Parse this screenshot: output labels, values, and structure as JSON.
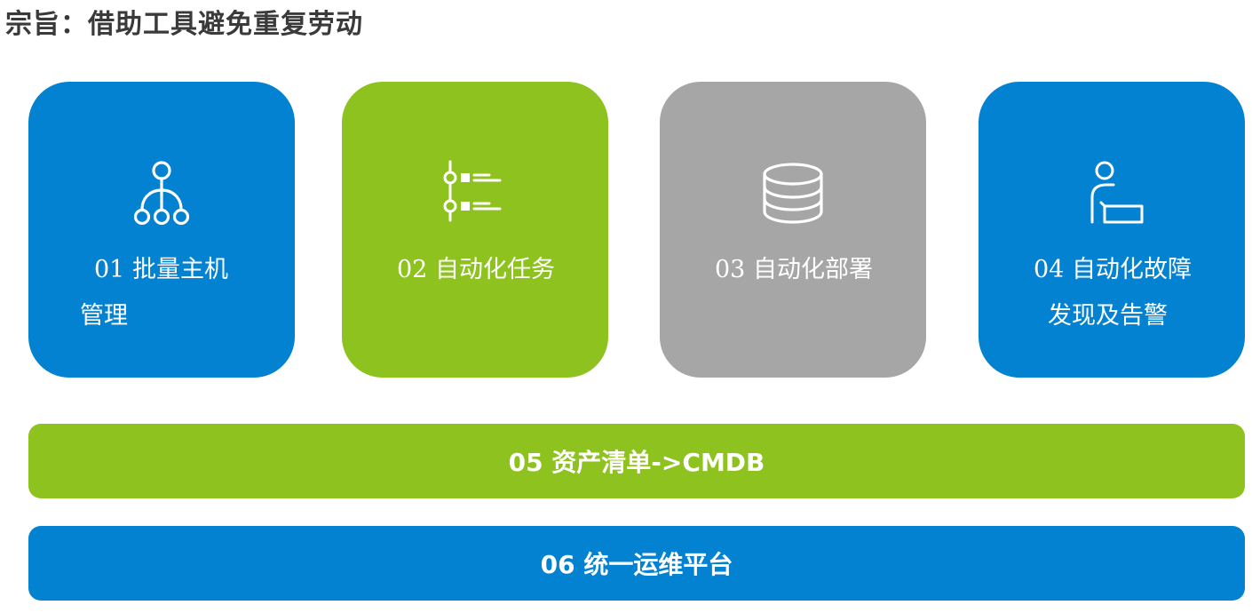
{
  "title": "宗旨：借助工具避免重复劳动",
  "colors": {
    "blue": "#0282D0",
    "green": "#8DC21F",
    "gray": "#A6A6A6",
    "title_text": "#3A3A3A"
  },
  "cards": [
    {
      "icon": "org-hierarchy-icon",
      "line1": "01  批量主机",
      "line2": "管理"
    },
    {
      "icon": "checklist-icon",
      "line1": "02  自动化任务",
      "line2": ""
    },
    {
      "icon": "database-icon",
      "line1": "03  自动化部署",
      "line2": ""
    },
    {
      "icon": "user-message-icon",
      "line1": "04  自动化故障",
      "line2": "发现及告警"
    }
  ],
  "bars": [
    {
      "label": "05 资产清单->CMDB"
    },
    {
      "label": "06 统一运维平台"
    }
  ]
}
